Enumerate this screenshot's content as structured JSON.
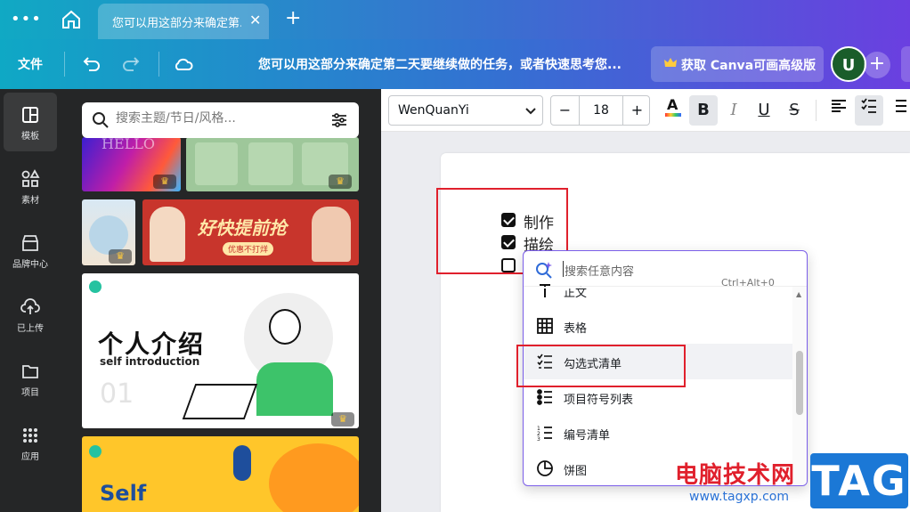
{
  "browser": {
    "menu_icon": "more-dots-icon",
    "home_icon": "home-icon",
    "tab_title": "您可以用这部分来确定第...",
    "tab_close": "✕",
    "new_tab": "+"
  },
  "header": {
    "file_menu": "文件",
    "doc_title": "您可以用这部分来确定第二天要继续做的任务，或者快速思考您...",
    "upgrade_label": "获取 Canva可画高级版",
    "avatar_letter": "U",
    "add_people": "+"
  },
  "rail": {
    "items": [
      {
        "label": "模板",
        "icon": "template-icon"
      },
      {
        "label": "素材",
        "icon": "elements-icon"
      },
      {
        "label": "品牌中心",
        "icon": "brand-icon"
      },
      {
        "label": "已上传",
        "icon": "upload-icon"
      },
      {
        "label": "项目",
        "icon": "folder-icon"
      },
      {
        "label": "应用",
        "icon": "apps-icon"
      }
    ]
  },
  "panel": {
    "search_placeholder": "搜索主题/节日/风格...",
    "templates": {
      "hello": "HELLO",
      "promo_title": "好快提前抢",
      "promo_sub": "优惠不打烊",
      "intro_title": "个人介绍",
      "intro_sub": "self introduction",
      "intro_num": "01",
      "self_title": "Self"
    }
  },
  "toolbar": {
    "font": "WenQuanYi",
    "font_size": "18",
    "minus": "−",
    "plus": "+",
    "bold": "B",
    "italic": "I",
    "underline": "U",
    "strike": "S"
  },
  "document": {
    "lines": [
      {
        "text": "制作",
        "checked": true
      },
      {
        "text": "描绘",
        "checked": true
      },
      {
        "text": "",
        "checked": false
      }
    ]
  },
  "dropdown": {
    "placeholder": "搜索任意内容",
    "items": [
      {
        "label": "正文",
        "shortcut": "Ctrl+Alt+0",
        "icon": "text-icon"
      },
      {
        "label": "表格",
        "shortcut": "",
        "icon": "table-icon"
      },
      {
        "label": "勾选式清单",
        "shortcut": "",
        "icon": "checklist-icon"
      },
      {
        "label": "项目符号列表",
        "shortcut": "",
        "icon": "bullet-list-icon"
      },
      {
        "label": "编号清单",
        "shortcut": "",
        "icon": "numbered-list-icon"
      },
      {
        "label": "饼图",
        "shortcut": "",
        "icon": "pie-chart-icon"
      }
    ]
  },
  "watermark": {
    "site_name": "电脑技术网",
    "url": "www.tagxp.com",
    "tag": "TAG"
  },
  "colors": {
    "highlight_box": "#e0202c",
    "dropdown_border": "#7b5ee9",
    "rail_bg": "#252627"
  }
}
